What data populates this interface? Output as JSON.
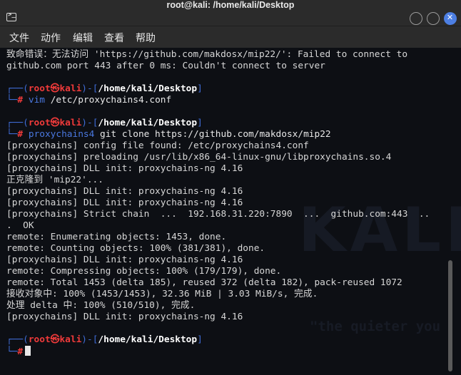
{
  "window": {
    "title": "root@kali: /home/kali/Desktop"
  },
  "menu": [
    "文件",
    "动作",
    "编辑",
    "查看",
    "帮助"
  ],
  "watermark": {
    "logo": "KALI",
    "slogan": "\"the quieter you"
  },
  "prompt": {
    "user": "root",
    "host": "kali",
    "symbol": "㉿",
    "path": "/home/kali/Desktop",
    "hash": "#"
  },
  "output": {
    "error1": "致命错误：无法访问 'https://github.com/makdosx/mip22/': Failed to connect to",
    "error2": "github.com port 443 after 0 ms: Couldn't connect to server",
    "p1": "[proxychains] config file found: /etc/proxychains4.conf",
    "p2": "[proxychains] preloading /usr/lib/x86_64-linux-gnu/libproxychains.so.4",
    "p3": "[proxychains] DLL init: proxychains-ng 4.16",
    "cloning": "正克隆到 'mip22'...",
    "p4": "[proxychains] DLL init: proxychains-ng 4.16",
    "p5": "[proxychains] DLL init: proxychains-ng 4.16",
    "p6": "[proxychains] Strict chain  ...  192.168.31.220:7890  ...  github.com:443  ..",
    "ok": ".  OK",
    "r1": "remote: Enumerating objects: 1453, done.",
    "r2": "remote: Counting objects: 100% (381/381), done.",
    "p7": "[proxychains] DLL init: proxychains-ng 4.16",
    "r3": "remote: Compressing objects: 100% (179/179), done.",
    "r4": "remote: Total 1453 (delta 185), reused 372 (delta 182), pack-reused 1072",
    "recv": "接收对象中: 100% (1453/1453), 32.36 MiB | 3.03 MiB/s, 完成.",
    "delta": "处理 delta 中: 100% (510/510), 完成.",
    "p8": "[proxychains] DLL init: proxychains-ng 4.16"
  },
  "commands": {
    "c1_cmd": "vim",
    "c1_args": " /etc/proxychains4.conf",
    "c2_cmd": "proxychains4",
    "c2_args": " git clone https://github.com/makdosx/mip22"
  },
  "colors": {
    "background": "#0d0f14",
    "prompt_frame": "#3f6cd6",
    "prompt_user": "#ef3a3a",
    "command": "#4a78e0",
    "close_button": "#4d7fe3"
  }
}
